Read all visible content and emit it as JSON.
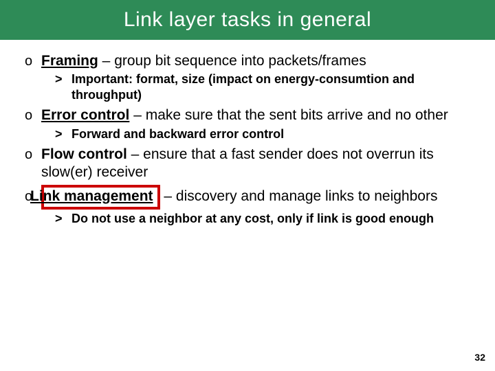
{
  "title": "Link layer tasks in general",
  "items": {
    "framing_term": "Framing",
    "framing_rest": " – group bit sequence into packets/frames",
    "framing_sub": "Important: format, size (impact on energy-consumtion and throughput)",
    "error_term": "Error control",
    "error_rest": " – make sure that the sent bits arrive and no other",
    "error_sub": "Forward and backward error control",
    "flow_term": "Flow control",
    "flow_rest": " – ensure that a fast sender does not overrun its slow(er) receiver",
    "link_term": "Link management",
    "link_rest": " – discovery and manage links to neighbors",
    "link_sub": "Do not use a neighbor at any cost, only if link is good enough"
  },
  "bullets": {
    "l1": "o",
    "l2": ">"
  },
  "page_number": "32"
}
